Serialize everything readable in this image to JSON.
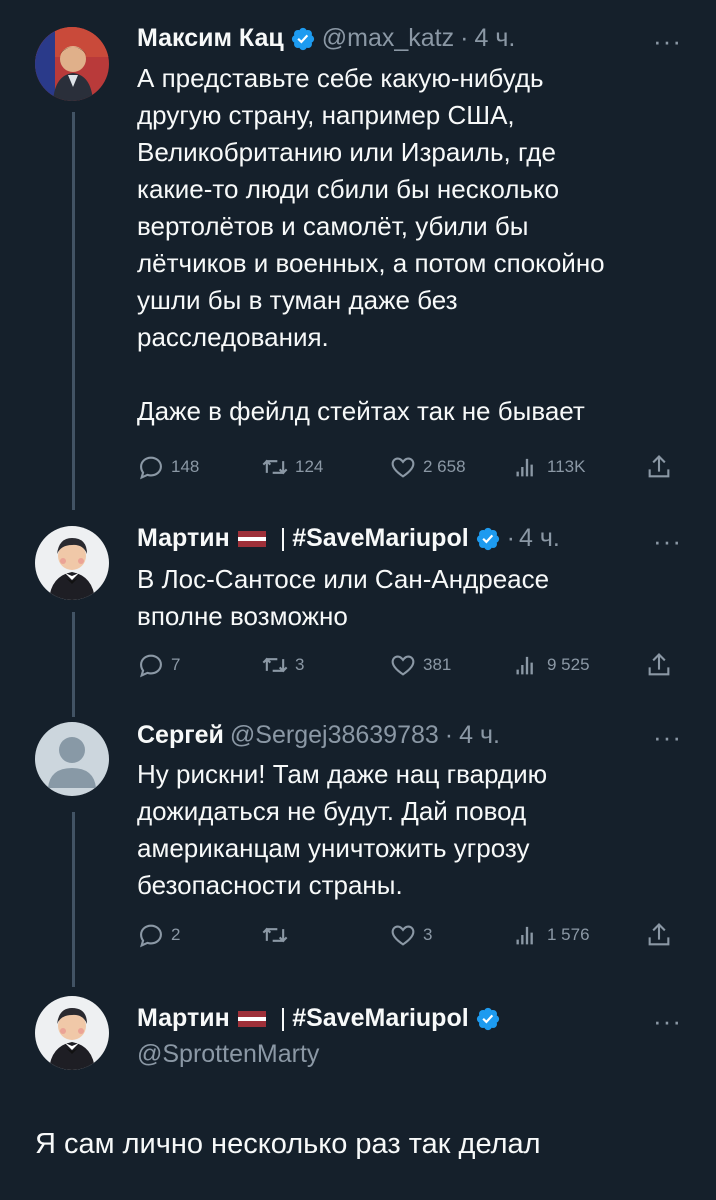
{
  "tweets": [
    {
      "name": "Максим Кац",
      "handle": "@max_katz",
      "time": "4 ч.",
      "text": "А представьте себе какую-нибудь\nдругую страну, например США,\nВеликобританию или Израиль, где\nкакие-то люди сбили бы несколько\nвертолётов и самолёт, убили бы\nлётчиков и военных, а потом спокойно\nушли бы в туман даже без\nрасследования.\n\nДаже в фейлд стейтах так не бывает",
      "replies": "148",
      "retweets": "124",
      "likes": "2 658",
      "views": "113K"
    },
    {
      "name": "Мартин",
      "name_suffix": "#SaveMariupol",
      "time": "4 ч.",
      "text": "В Лос-Сантосе или Сан-Андреасе\nвполне возможно",
      "replies": "7",
      "retweets": "3",
      "likes": "381",
      "views": "9 525"
    },
    {
      "name": "Сергей",
      "handle": "@Sergej38639783",
      "time": "4 ч.",
      "text": "Ну рискни! Там даже нац гвардию\nдожидаться не будут. Дай повод\nамериканцам уничтожить угрозу\nбезопасности страны.",
      "replies": "2",
      "retweets": "",
      "likes": "3",
      "views": "1 576"
    },
    {
      "name": "Мартин",
      "name_suffix": "#SaveMariupol",
      "handle": "@SprottenMarty",
      "text": "Я сам лично несколько раз так делал"
    }
  ],
  "ui": {
    "more": "···",
    "dot": "·",
    "separator": "|"
  },
  "colors": {
    "background": "#15202b",
    "verified": "#1d9bf0",
    "muted": "#8b98a5"
  }
}
